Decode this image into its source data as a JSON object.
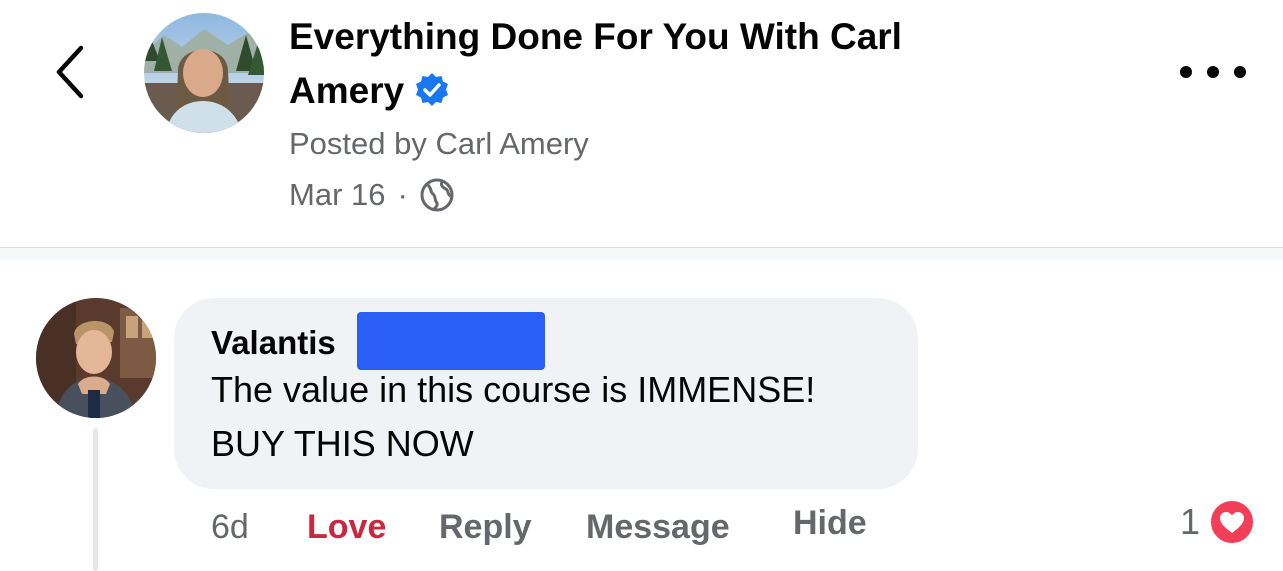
{
  "header": {
    "title": "Everything Done For You With Carl Amery",
    "posted_by": "Posted by Carl Amery",
    "date": "Mar 16",
    "separator": "·",
    "privacy_icon": "globe-icon",
    "back_icon": "chevron-left-icon",
    "more_icon": "more-horizontal-icon",
    "verified_icon": "verified-badge-icon"
  },
  "comment": {
    "author": "Valantis",
    "text_line1": "The value in this course is IMMENSE!",
    "text_line2": "BUY THIS NOW",
    "actions": {
      "time": "6d",
      "love": "Love",
      "reply": "Reply",
      "message": "Message",
      "hide": "Hide"
    },
    "reaction_count": "1",
    "reaction_icon": "heart-icon"
  },
  "colors": {
    "verified": "#1877f2",
    "love": "#c9283e",
    "redaction": "#2a5ff5",
    "bubble": "#f0f2f5",
    "secondary_text": "#65676b",
    "heart_badge": "#f33e58"
  }
}
